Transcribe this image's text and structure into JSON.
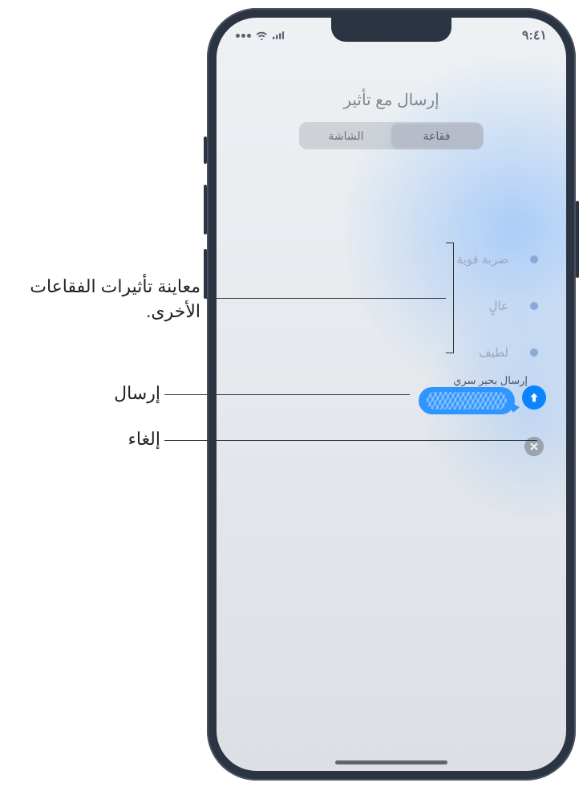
{
  "statusbar": {
    "time": "٩:٤١"
  },
  "header": {
    "title": "إرسال مع تأثير"
  },
  "tabs": {
    "bubble": "فقاعة",
    "screen": "الشاشة"
  },
  "effects": {
    "slam": "ضربة قوية",
    "loud": "عالٍ",
    "gentle": "لطيف",
    "invisible": "إرسال بحبر سري"
  },
  "callouts": {
    "preview": "معاينة تأثيرات الفقاعات الأخرى.",
    "send": "إرسال",
    "cancel": "إلغاء"
  },
  "colors": {
    "accent": "#0a84ff",
    "bubble": "#2f95ff"
  }
}
